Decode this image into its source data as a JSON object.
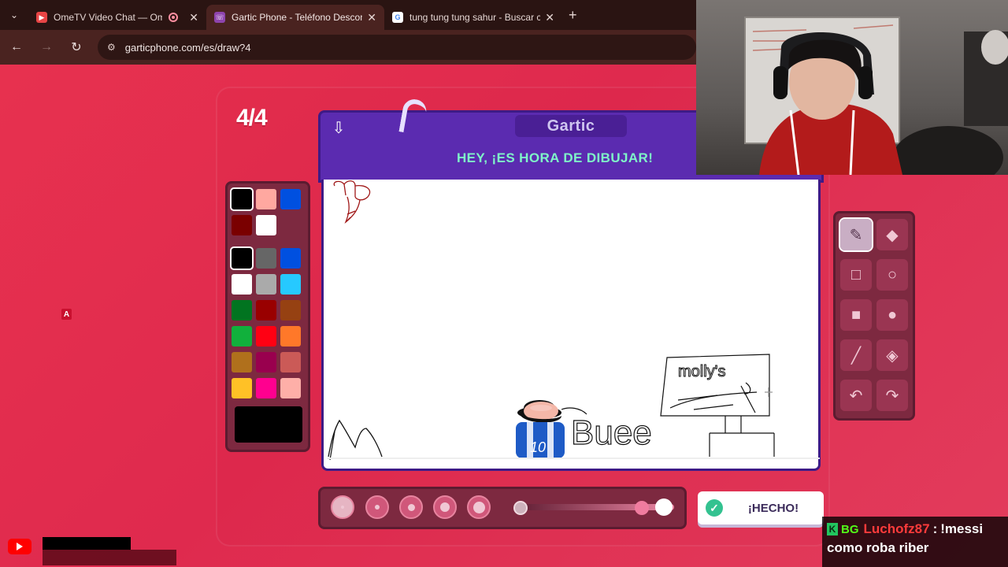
{
  "browser": {
    "tabs": [
      {
        "title": "OmeTV Video Chat — Ome",
        "favicon_color": "#e84545",
        "recording": true
      },
      {
        "title": "Gartic Phone - Teléfono Descon",
        "favicon_color": "#8e44ad",
        "active": true
      },
      {
        "title": "tung tung tung sahur - Buscar c",
        "favicon_color": "#ffffff"
      }
    ],
    "url": "garticphone.com/es/draw?4"
  },
  "game": {
    "round": "4/4",
    "logo": "Gartic",
    "instruction": "HEY, ¡ES HORA DE DIBUJAR!",
    "canvas_texts": {
      "sign": "molly's",
      "shirt_number": "10",
      "word": "Buee"
    },
    "done_label": "¡HECHO!",
    "colors": {
      "header": "#5b2bb0",
      "instruction": "#7ff5c8",
      "current_color": "#000000"
    },
    "palette_top": [
      "#000000",
      "#ffa8a0",
      "#0050e0",
      "#7a0000",
      "#ffffff"
    ],
    "palette": [
      "#000000",
      "#666666",
      "#0050e0",
      "#ffffff",
      "#aaaaaa",
      "#26c9ff",
      "#017420",
      "#990000",
      "#964112",
      "#11b03c",
      "#ff0013",
      "#ff7829",
      "#b0701c",
      "#99004e",
      "#cb5a57",
      "#ffc126",
      "#ff008f",
      "#feafa8"
    ],
    "tools": [
      {
        "name": "pencil-icon",
        "glyph": "✎",
        "selected": true
      },
      {
        "name": "eraser-icon",
        "glyph": "◆"
      },
      {
        "name": "rectangle-outline-icon",
        "glyph": "□"
      },
      {
        "name": "circle-outline-icon",
        "glyph": "○"
      },
      {
        "name": "rectangle-filled-icon",
        "glyph": "■"
      },
      {
        "name": "circle-filled-icon",
        "glyph": "●"
      },
      {
        "name": "line-icon",
        "glyph": "╱"
      },
      {
        "name": "fill-bucket-icon",
        "glyph": "◈"
      },
      {
        "name": "undo-icon",
        "glyph": "↶"
      },
      {
        "name": "redo-icon",
        "glyph": "↷"
      }
    ],
    "opacity": 0.85
  },
  "stream": {
    "chat": {
      "badge": "K",
      "sub_badge": "BG",
      "user": "Luchofz87",
      "separator": ":",
      "message_start": "!messi",
      "message_end": "como roba riber"
    },
    "stray_label": "A"
  }
}
